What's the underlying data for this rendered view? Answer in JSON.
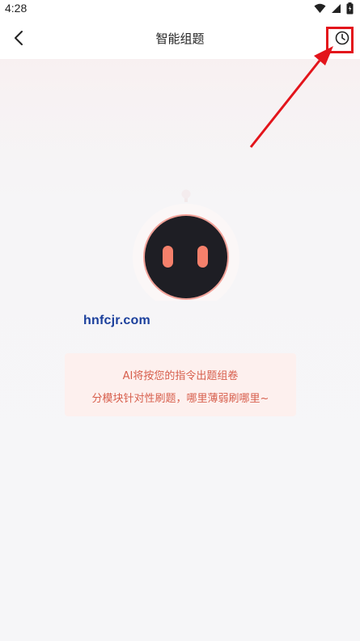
{
  "status_bar": {
    "time": "4:28",
    "icons": [
      "wifi-icon",
      "signal-icon",
      "battery-icon"
    ]
  },
  "header": {
    "back_icon": "chevron-left-icon",
    "title": "智能组题",
    "history_icon": "clock-icon"
  },
  "annotation": {
    "highlight_color": "#e3141b"
  },
  "robot": {
    "icon": "ai-robot-icon",
    "face_color": "#1e1e24",
    "eye_color": "#f5806b",
    "ring_color": "#f2a39a"
  },
  "watermark": {
    "text": "hnfcjr.com"
  },
  "info_card": {
    "line1": "AI将按您的指令出题组卷",
    "line2": "分模块针对性刷题，哪里薄弱刷哪里~"
  }
}
